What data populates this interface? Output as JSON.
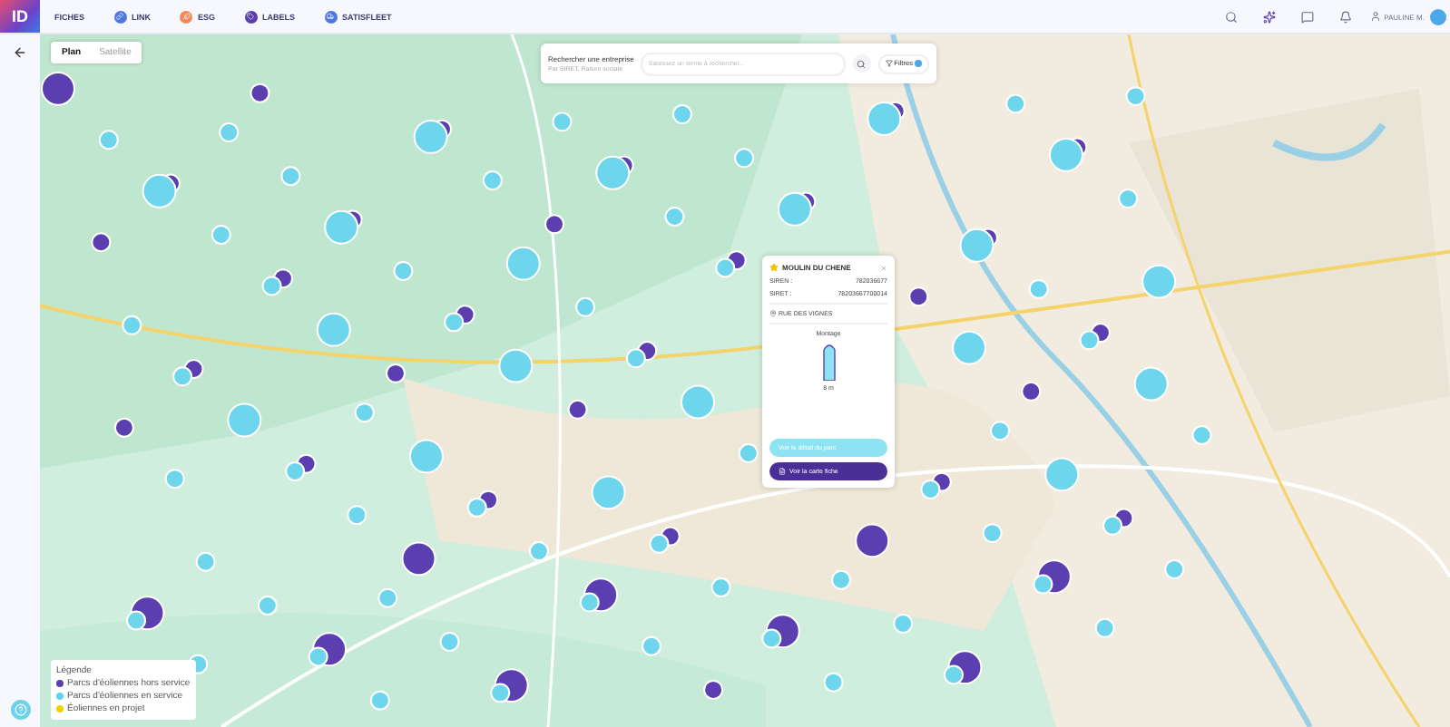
{
  "logo": {
    "text": "ID"
  },
  "nav": [
    {
      "label": "FICHES",
      "kind": "plain"
    },
    {
      "label": "LINK",
      "kind": "link"
    },
    {
      "label": "ESG",
      "kind": "esg"
    },
    {
      "label": "LABELS",
      "kind": "label"
    },
    {
      "label": "SATISFLEET",
      "kind": "fleet"
    }
  ],
  "user": {
    "name": "PAULINE M."
  },
  "map_tabs": [
    {
      "label": "Plan",
      "selected": true
    },
    {
      "label": "Satellite",
      "selected": false
    }
  ],
  "search": {
    "title": "Rechercher une entreprise",
    "subtitle": "Par SIRET, Raison sociale",
    "placeholder": "Saisissez un terme à rechercher...",
    "filter_label": "Filtres"
  },
  "popup": {
    "title": "MOULIN DU CHENE",
    "fields": [
      {
        "label": "SIREN :",
        "value": "782036677"
      },
      {
        "label": "SIRET :",
        "value": "78203667700014"
      }
    ],
    "address": "RUE DES VIGNES",
    "equipment_label": "Montage",
    "equipment_value": "8 m",
    "primary_button": "Voir le détail du parc",
    "secondary_button": "Voir la carte fiche"
  },
  "legend": {
    "title": "Légende",
    "items": [
      {
        "label": "Parcs d'éoliennes hors service",
        "color": "#5b3fb0"
      },
      {
        "label": "Parcs d'éoliennes en service",
        "color": "#5ad8ea"
      },
      {
        "label": "Éoliennes en projet",
        "color": "#f5d000"
      }
    ]
  }
}
